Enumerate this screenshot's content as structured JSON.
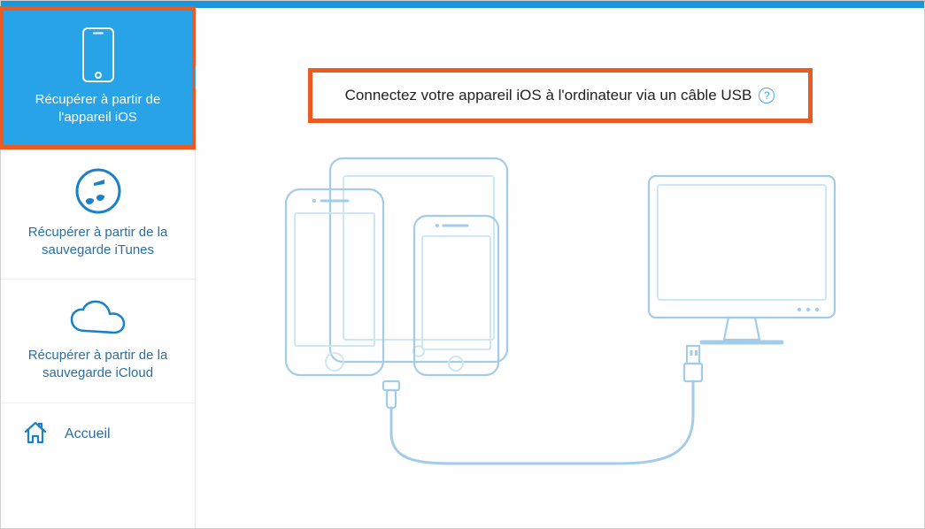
{
  "sidebar": {
    "items": [
      {
        "label": "Récupérer à partir de l'appareil iOS",
        "icon": "phone-icon",
        "active": true
      },
      {
        "label": "Récupérer à partir de la sauvegarde iTunes",
        "icon": "itunes-icon",
        "active": false
      },
      {
        "label": "Récupérer à partir de la sauvegarde iCloud",
        "icon": "cloud-icon",
        "active": false
      }
    ],
    "home_label": "Accueil"
  },
  "main": {
    "headline": "Connectez votre appareil iOS à l'ordinateur via un câble USB",
    "help_glyph": "?"
  },
  "colors": {
    "accent": "#28a3e8",
    "highlight": "#ec5a23",
    "link": "#2b6ea3",
    "device_stroke": "#a3cce8"
  }
}
